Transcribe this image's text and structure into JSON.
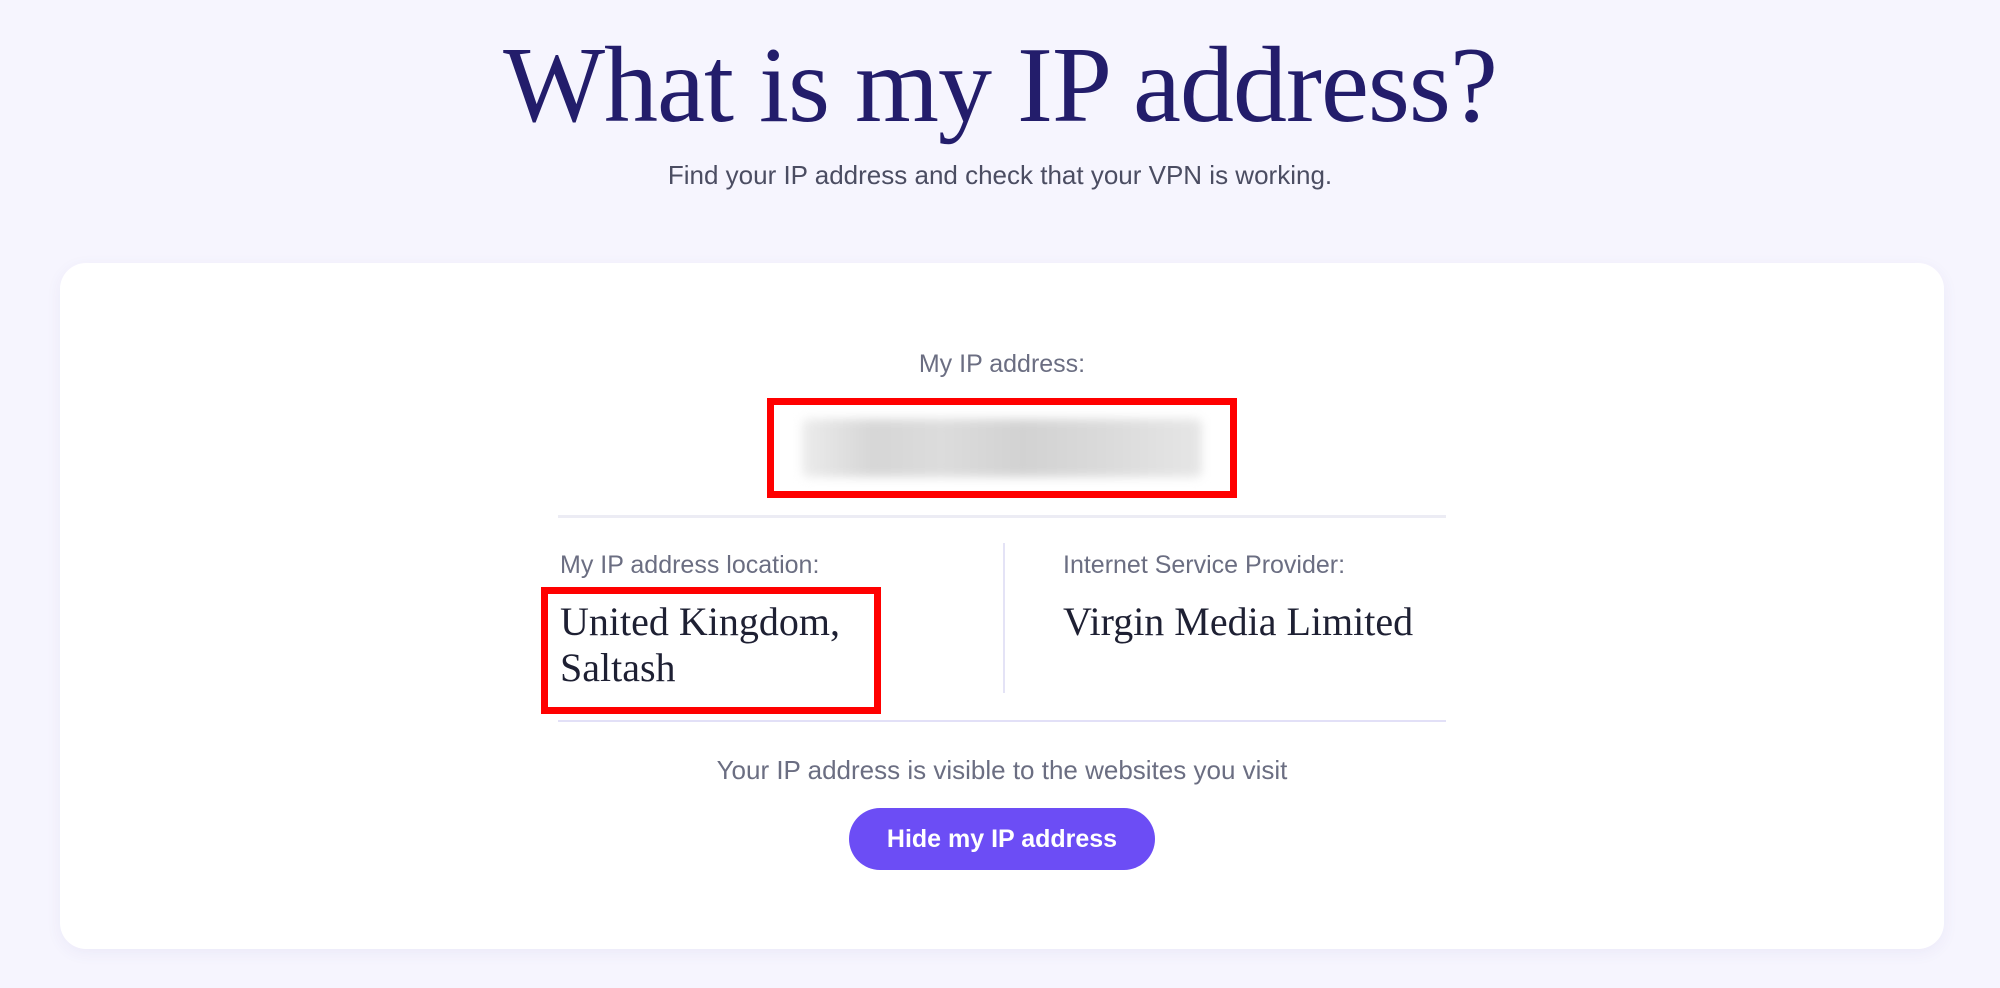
{
  "header": {
    "title": "What is my IP address?",
    "subtitle": "Find your IP address and check that your VPN is working."
  },
  "ip_card": {
    "ip_label": "My IP address:",
    "ip_value": "",
    "location_label": "My IP address location:",
    "location_line1": "United Kingdom,",
    "location_line2": "Saltash",
    "isp_label": "Internet Service Provider:",
    "isp_value": "Virgin Media Limited",
    "visibility_note": "Your IP address is visible to the websites you visit",
    "hide_button_label": "Hide my IP address"
  },
  "colors": {
    "page_background": "#f6f5fe",
    "title_color": "#231d6b",
    "button_color": "#6c4df5",
    "highlight_border": "#ff0000"
  }
}
